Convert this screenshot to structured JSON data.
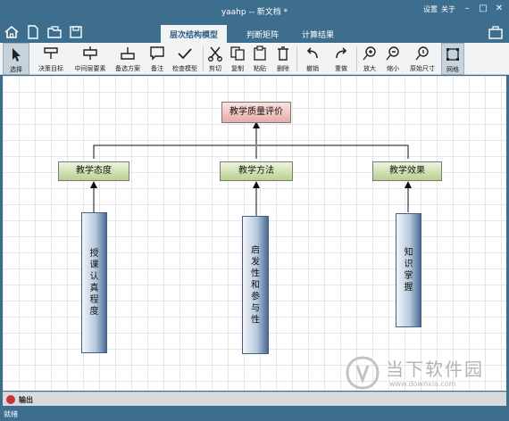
{
  "window": {
    "title": "yaahp -- 新文档 *",
    "settings": "设置",
    "about": "关于"
  },
  "tabs": [
    "层次结构模型",
    "判断矩阵",
    "计算结果"
  ],
  "toolbar": [
    {
      "label": "选择",
      "icon": "cursor-icon"
    },
    {
      "label": "决策目标",
      "icon": "decision-goal-icon"
    },
    {
      "label": "中间层要素",
      "icon": "intermediate-factor-icon"
    },
    {
      "label": "备选方案",
      "icon": "alternative-icon"
    },
    {
      "label": "备注",
      "icon": "comment-icon"
    },
    {
      "label": "检查模型",
      "icon": "check-icon"
    },
    {
      "label": "剪切",
      "icon": "scissors-icon"
    },
    {
      "label": "复制",
      "icon": "copy-icon"
    },
    {
      "label": "粘贴",
      "icon": "paste-icon"
    },
    {
      "label": "删除",
      "icon": "trash-icon"
    },
    {
      "label": "撤销",
      "icon": "undo-icon"
    },
    {
      "label": "重做",
      "icon": "redo-icon"
    },
    {
      "label": "放大",
      "icon": "zoom-in-icon"
    },
    {
      "label": "缩小",
      "icon": "zoom-out-icon"
    },
    {
      "label": "原始尺寸",
      "icon": "zoom-reset-icon"
    },
    {
      "label": "网格",
      "icon": "grid-icon"
    }
  ],
  "model": {
    "goal": "教学质量评价",
    "criteria": [
      "教学态度",
      "教学方法",
      "教学效果"
    ],
    "alternatives": [
      "授课认真程度",
      "启发性和参与性",
      "知识掌握"
    ]
  },
  "watermark": {
    "name": "当下软件园",
    "url": "www.downxia.com"
  },
  "output": {
    "label": "输出"
  },
  "status": {
    "text": "就绪"
  }
}
